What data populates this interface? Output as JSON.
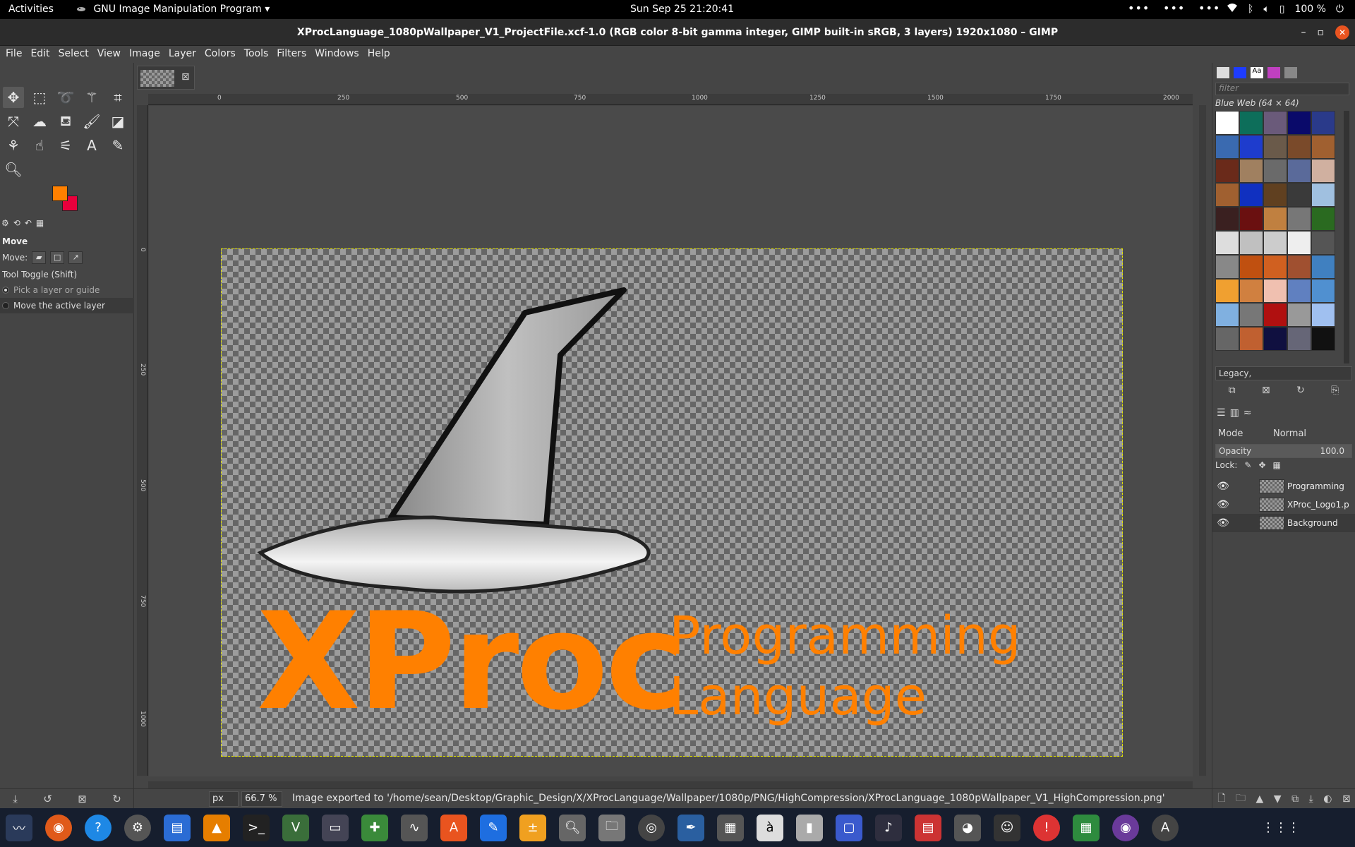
{
  "topbar": {
    "activities": "Activities",
    "app_name": "GNU Image Manipulation Program",
    "clock": "Sun Sep 25  21:20:41",
    "battery": "100 %"
  },
  "window": {
    "title": "XProcLanguage_1080pWallpaper_V1_ProjectFile.xcf-1.0 (RGB color 8-bit gamma integer, GIMP built-in sRGB, 3 layers) 1920x1080 – GIMP"
  },
  "menu": [
    "File",
    "Edit",
    "Select",
    "View",
    "Image",
    "Layer",
    "Colors",
    "Tools",
    "Filters",
    "Windows",
    "Help"
  ],
  "colors": {
    "fg": "#ff8000",
    "bg": "#e8003c",
    "accent": "#e95420"
  },
  "tool_options": {
    "title": "Move",
    "move_label": "Move:",
    "toggle_label": "Tool Toggle  (Shift)",
    "opt1": "Pick a layer or guide",
    "opt2": "Move the active layer"
  },
  "rulers": {
    "h": [
      "0",
      "250",
      "500",
      "750",
      "1000",
      "1250",
      "1500",
      "1750",
      "2000"
    ],
    "v": [
      "0",
      "250",
      "500",
      "750",
      "1000"
    ]
  },
  "canvas": {
    "logo_main": "XProc",
    "logo_line1": "Programming",
    "logo_line2": "Language"
  },
  "status": {
    "unit": "px",
    "zoom": "66.7 %",
    "message": "Image exported to '/home/sean/Desktop/Graphic_Design/X/XProcLanguage/Wallpaper/1080p/PNG/HighCompression/XProcLanguage_1080pWallpaper_V1_HighCompression.png'"
  },
  "patterns_panel": {
    "filter_placeholder": "filter",
    "selected_name": "Blue Web (64 × 64)",
    "tag": "Legacy,"
  },
  "layers_panel": {
    "mode_label": "Mode",
    "mode_value": "Normal",
    "opacity_label": "Opacity",
    "opacity_value": "100.0",
    "opacity_fraction": 1.0,
    "lock_label": "Lock:",
    "layers": [
      {
        "name": "Programming"
      },
      {
        "name": "XProc_Logo1.p"
      },
      {
        "name": "Background"
      }
    ]
  }
}
